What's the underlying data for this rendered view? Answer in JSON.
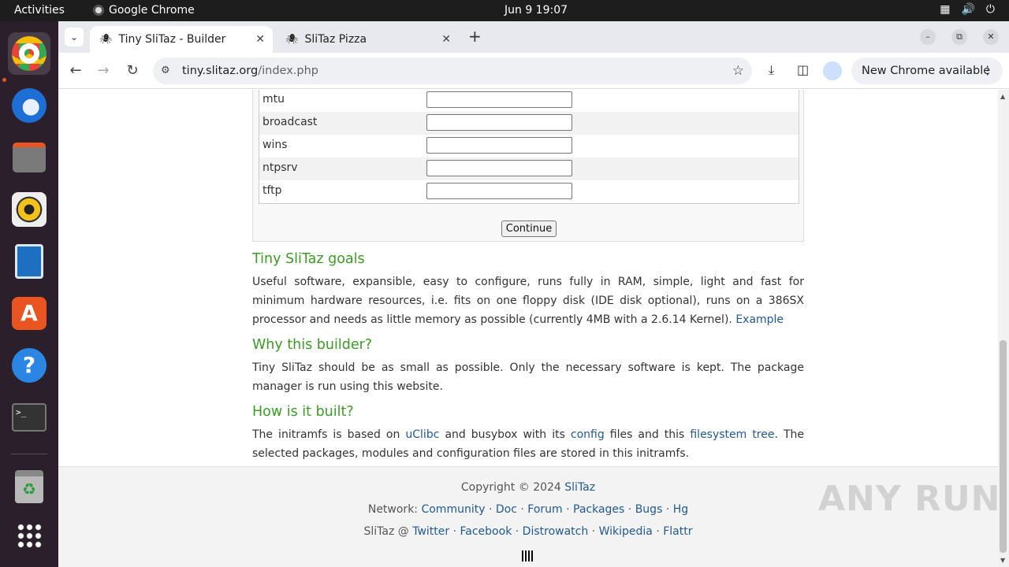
{
  "system": {
    "activities": "Activities",
    "app_name": "Google Chrome",
    "clock": "Jun 9  19:07"
  },
  "browser": {
    "tabs": [
      {
        "title": "Tiny SliTaz - Builder",
        "active": true
      },
      {
        "title": "SliTaz Pizza",
        "active": false
      }
    ],
    "url_host": "tiny.slitaz.org",
    "url_path": "/index.php",
    "update_label": "New Chrome available"
  },
  "form": {
    "rows": [
      {
        "label": "mtu",
        "value": ""
      },
      {
        "label": "broadcast",
        "value": ""
      },
      {
        "label": "wins",
        "value": ""
      },
      {
        "label": "ntpsrv",
        "value": ""
      },
      {
        "label": "tftp",
        "value": ""
      }
    ],
    "continue_label": "Continue"
  },
  "sections": {
    "goals_title": "Tiny SliTaz goals",
    "goals_text": "Useful software, expansible, easy to configure, runs fully in RAM, simple, light and fast for minimum hardware resources, i.e. fits on one floppy disk (IDE disk optional), runs on a 386SX processor and needs as little memory as possible (currently 4MB with a 2.6.14 Kernel).",
    "goals_link": "Example",
    "why_title": "Why this builder?",
    "why_text": "Tiny SliTaz should be as small as possible. Only the necessary software is kept. The package manager is run using this website.",
    "how_title": "How is it built?",
    "how_text_1": "The initramfs is based on",
    "how_link_1": "uClibc",
    "how_text_2": "and busybox with its",
    "how_link_2": "config",
    "how_text_3": "files and this",
    "how_link_3": "filesystem tree",
    "how_text_4": ". The selected packages, modules and configuration files are stored in this initramfs."
  },
  "footer": {
    "copyright": "Copyright © 2024",
    "copyright_link": "SliTaz",
    "network_label": "Network:",
    "network_links": [
      "Community",
      "Doc",
      "Forum",
      "Packages",
      "Bugs",
      "Hg"
    ],
    "social_label": "SliTaz @",
    "social_links": [
      "Twitter",
      "Facebook",
      "Distrowatch",
      "Wikipedia",
      "Flattr"
    ]
  },
  "watermark": "ANY RUN"
}
